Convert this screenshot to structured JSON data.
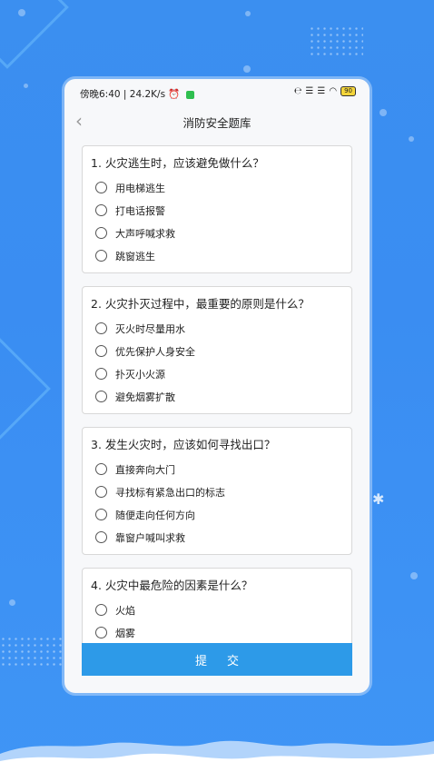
{
  "status": {
    "time_speed": "傍晚6:40 | 24.2K/s",
    "battery": "90"
  },
  "header": {
    "back_icon": "chevron-left-icon",
    "title": "消防安全题库"
  },
  "questions": [
    {
      "text": "1. 火灾逃生时，应该避免做什么？",
      "options": [
        "用电梯逃生",
        "打电话报警",
        "大声呼喊求救",
        "跳窗逃生"
      ]
    },
    {
      "text": "2. 火灾扑灭过程中，最重要的原则是什么？",
      "options": [
        "灭火时尽量用水",
        "优先保护人身安全",
        "扑灭小火源",
        "避免烟雾扩散"
      ]
    },
    {
      "text": "3. 发生火灾时，应该如何寻找出口？",
      "options": [
        "直接奔向大门",
        "寻找标有紧急出口的标志",
        "随便走向任何方向",
        "靠窗户喊叫求救"
      ]
    },
    {
      "text": "4. 火灾中最危险的因素是什么？",
      "options": [
        "火焰",
        "烟雾"
      ]
    }
  ],
  "submit_label": "提交",
  "colors": {
    "background": "#3b8ff0",
    "submit": "#2d9ae8"
  }
}
